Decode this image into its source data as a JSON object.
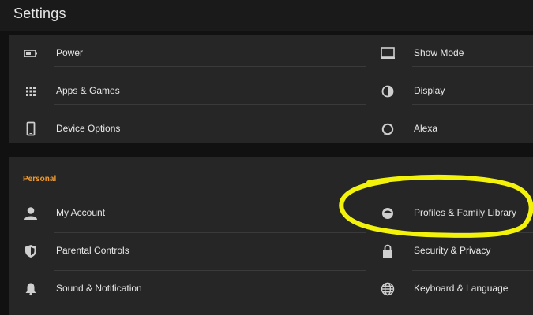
{
  "header": {
    "title": "Settings"
  },
  "card1": {
    "items": [
      {
        "label": "Power",
        "icon": "battery-icon"
      },
      {
        "label": "Show Mode",
        "icon": "monitor-icon"
      },
      {
        "label": "Apps & Games",
        "icon": "apps-grid-icon"
      },
      {
        "label": "Display",
        "icon": "contrast-icon"
      },
      {
        "label": "Device Options",
        "icon": "tablet-icon"
      },
      {
        "label": "Alexa",
        "icon": "alexa-ring-icon"
      }
    ]
  },
  "card2": {
    "section_label": "Personal",
    "items": [
      {
        "label": "My Account",
        "icon": "person-icon"
      },
      {
        "label": "Profiles & Family Library",
        "icon": "profile-face-icon"
      },
      {
        "label": "Parental Controls",
        "icon": "shield-icon"
      },
      {
        "label": "Security & Privacy",
        "icon": "lock-icon"
      },
      {
        "label": "Sound & Notification",
        "icon": "bell-icon"
      },
      {
        "label": "Keyboard & Language",
        "icon": "globe-icon"
      }
    ]
  },
  "colors": {
    "background": "#111111",
    "card": "#262626",
    "section_accent": "#f19a29",
    "highlight_annotation": "#f2f20a",
    "icon": "#cfcfcf"
  }
}
